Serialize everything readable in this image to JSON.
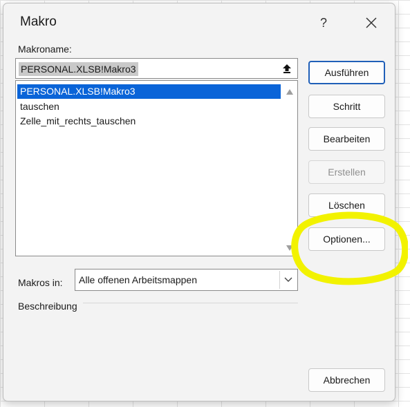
{
  "dialog": {
    "title": "Makro",
    "help_label": "?"
  },
  "macro_name": {
    "label": "Makroname:",
    "value": "PERSONAL.XLSB!Makro3"
  },
  "macro_list": {
    "items": [
      "PERSONAL.XLSB!Makro3",
      "tauschen",
      "Zelle_mit_rechts_tauschen"
    ],
    "selected_index": 0
  },
  "macros_in": {
    "label": "Makros in:",
    "value": "Alle offenen Arbeitsmappen"
  },
  "description": {
    "label": "Beschreibung"
  },
  "buttons": {
    "run": "Ausführen",
    "step": "Schritt",
    "edit": "Bearbeiten",
    "create": "Erstellen",
    "delete": "Löschen",
    "options": "Optionen...",
    "cancel": "Abbrechen"
  },
  "colors": {
    "selection": "#0a64d8",
    "default_button_border": "#1f5fb8",
    "highlight_annotation": "#f2f200"
  },
  "icons": {
    "close": "close-icon",
    "upload": "upload-arrow-icon",
    "scroll_up": "triangle-up-icon",
    "scroll_down": "triangle-down-icon",
    "dropdown": "chevron-down-icon"
  }
}
